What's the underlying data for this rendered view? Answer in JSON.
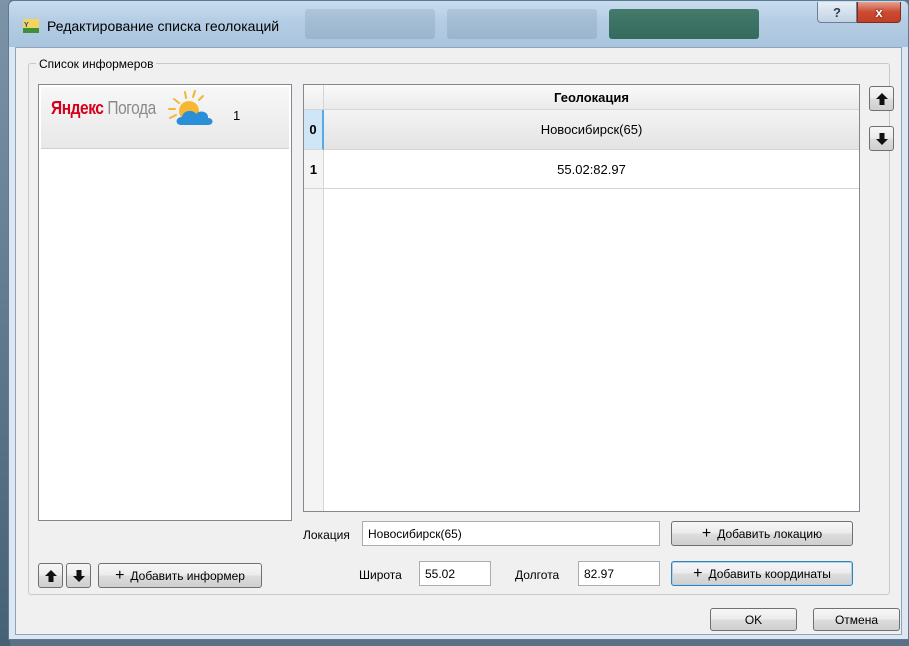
{
  "window": {
    "title": "Редактирование списка геолокаций",
    "help_label": "?",
    "close_label": "x"
  },
  "informers": {
    "group_label": "Список информеров",
    "items": [
      {
        "logo_part1": "Яндекс",
        "logo_part2": "Погода",
        "count": "1",
        "icon": "sun-cloud-icon"
      }
    ],
    "add_label": "Добавить информер"
  },
  "geo_table": {
    "column_header": "Геолокация",
    "rows": [
      {
        "index": "0",
        "value": "Новосибирск(65)"
      },
      {
        "index": "1",
        "value": "55.02:82.97"
      }
    ]
  },
  "location": {
    "label": "Локация",
    "value": "Новосибирск(65)",
    "add_label": "Добавить локацию"
  },
  "coordinates": {
    "lat_label": "Широта",
    "lat_value": "55.02",
    "lon_label": "Долгота",
    "lon_value": "82.97",
    "add_label": "Добавить координаты"
  },
  "dialog": {
    "ok_label": "OK",
    "cancel_label": "Отмена"
  },
  "colors": {
    "accent": "#5aa9e0",
    "titlebar": "#b4cde4",
    "close": "#c33f27"
  }
}
